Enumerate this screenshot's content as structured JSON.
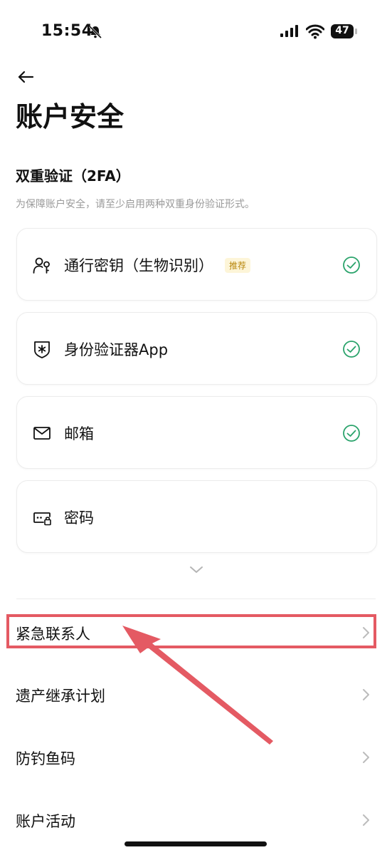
{
  "status_bar": {
    "time": "15:54",
    "battery": "47"
  },
  "header": {
    "title": "账户安全"
  },
  "two_fa": {
    "title": "双重验证（2FA）",
    "description": "为保障账户安全，请至少启用两种双重身份验证形式。",
    "items": [
      {
        "label": "通行密钥（生物识别）",
        "tag": "推荐",
        "icon": "passkey-icon",
        "enabled": true
      },
      {
        "label": "身份验证器App",
        "icon": "authenticator-icon",
        "enabled": true
      },
      {
        "label": "邮箱",
        "icon": "mail-icon",
        "enabled": true
      },
      {
        "label": "密码",
        "icon": "password-icon",
        "enabled": false
      }
    ]
  },
  "menu": [
    {
      "label": "紧急联系人",
      "highlighted": true
    },
    {
      "label": "遗产继承计划"
    },
    {
      "label": "防钓鱼码"
    },
    {
      "label": "账户活动"
    }
  ],
  "colors": {
    "check": "#2aa36b",
    "highlight": "#e45a63",
    "tag_text": "#b8860b",
    "tag_bg": "#fdf5d8"
  }
}
